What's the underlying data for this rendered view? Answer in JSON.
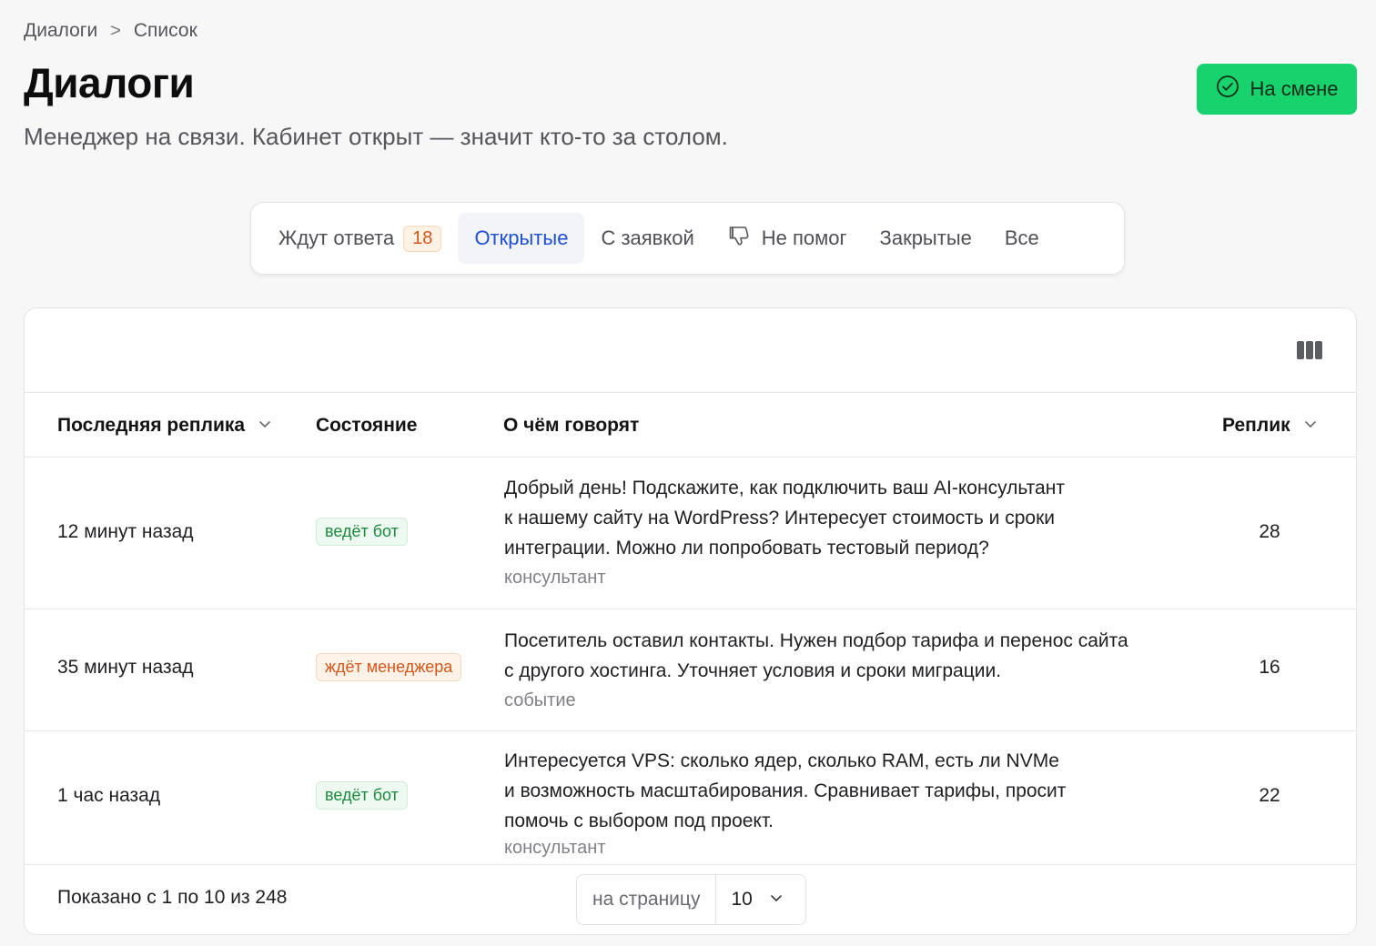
{
  "breadcrumb": {
    "root": "Диалоги",
    "separator": ">",
    "current": "Список"
  },
  "page": {
    "title": "Диалоги",
    "subtitle": "Менеджер на связи. Кабинет открыт — значит кто-то за столом."
  },
  "shift_button": {
    "label": "На смене",
    "icon": "check-circle-icon"
  },
  "tabs": [
    {
      "label": "Ждут ответа",
      "count": "18",
      "active": false
    },
    {
      "label": "Открытые",
      "active": true
    },
    {
      "label": "С заявкой",
      "active": false
    },
    {
      "label": "Не помог",
      "icon": "thumbs-down-icon",
      "active": false
    },
    {
      "label": "Закрытые",
      "active": false
    },
    {
      "label": "Все",
      "active": false
    }
  ],
  "table": {
    "toolbar_icon": "columns-icon",
    "headers": {
      "last_reply": "Последняя реплика",
      "state": "Состояние",
      "topic": "О чём говорят",
      "replies": "Реплик"
    },
    "rows": [
      {
        "time": "12 минут назад",
        "state": "ведёт бот",
        "topic_lines": [
          "Добрый день! Подскажите, как подключить ваш AI-консультант",
          "к нашему сайту на WordPress? Интересует стоимость и сроки",
          "интеграции. Можно ли попробовать тестовый период?"
        ],
        "source": "консультант",
        "replies": "28"
      },
      {
        "time": "35 минут назад",
        "state": "ждёт менеджера",
        "topic_lines": [
          "Посетитель оставил контакты. Нужен подбор тарифа и перенос сайта",
          "с другого хостинга. Уточняет условия и сроки миграции."
        ],
        "source": "событие",
        "replies": "16"
      },
      {
        "time": "1 час назад",
        "state": "ведёт бот",
        "topic_lines": [
          "Интересуется VPS: сколько ядер, сколько RAM, есть ли NVMe",
          "и возможность масштабирования. Сравнивает тарифы, просит",
          "помочь с выбором под проект."
        ],
        "source": "консультант",
        "replies": "22"
      }
    ]
  },
  "footer": {
    "shown": "Показано с 1 по 10 из 248",
    "per_page_label": "на страницу",
    "per_page_value": "10"
  },
  "colors": {
    "accent_green": "#18d36d",
    "active_tab_text": "#1f4fd8",
    "badge_orange": "#d4561a",
    "badge_green": "#1d8a3d"
  }
}
